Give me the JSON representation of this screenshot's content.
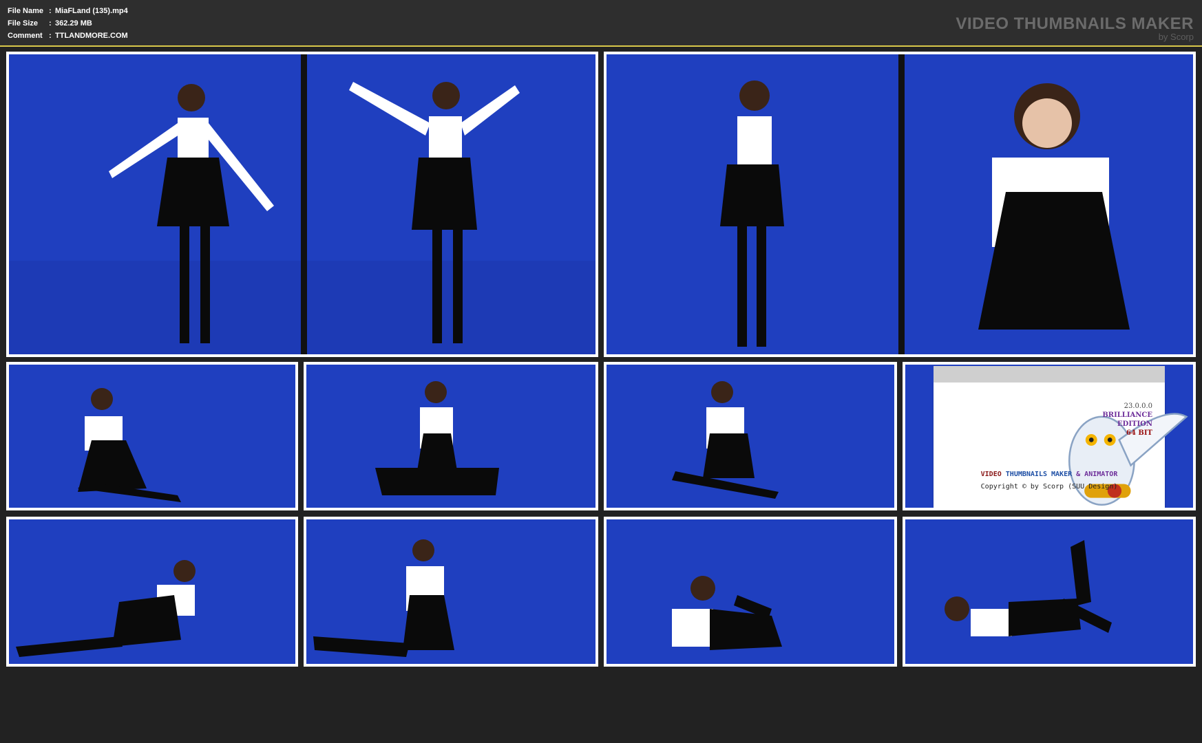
{
  "header": {
    "rows": [
      {
        "label": "File Name",
        "sep": ":",
        "value": "MiaFLand (135).mp4"
      },
      {
        "label": "File Size",
        "sep": ":",
        "value": "362.29 MB"
      },
      {
        "label": "Comment",
        "sep": ":",
        "value": "TTLANDMORE.COM"
      }
    ],
    "brand_title": "VIDEO THUMBNAILS MAKER",
    "brand_sub": "by Scorp"
  },
  "ad": {
    "version": "23.0.0.0",
    "edition1": "BRILLIANCE",
    "edition2": "EDITION",
    "bits": "64 BIT",
    "name1": "VIDEO",
    "name2": "THUMBNAILS MAKER",
    "name3": "& ANIMATOR",
    "copyright": "Copyright © by Scorp (SUU Design)"
  },
  "colors": {
    "backdrop": "#1f3fbf",
    "backdrop_dark": "#10238a",
    "frame": "#ffffff",
    "accent": "#d9c84a"
  }
}
